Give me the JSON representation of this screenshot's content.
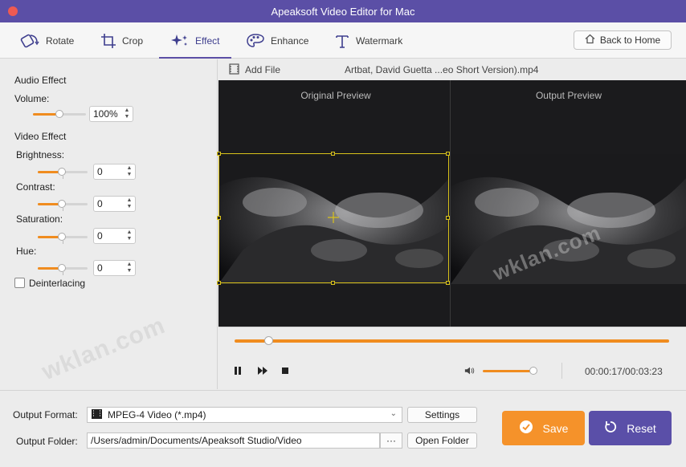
{
  "window": {
    "title": "Apeaksoft Video Editor for Mac"
  },
  "tabs": [
    {
      "label": "Rotate",
      "icon": "rotate-icon"
    },
    {
      "label": "Crop",
      "icon": "crop-icon"
    },
    {
      "label": "Effect",
      "icon": "effect-icon",
      "active": true
    },
    {
      "label": "Enhance",
      "icon": "enhance-icon"
    },
    {
      "label": "Watermark",
      "icon": "watermark-icon"
    }
  ],
  "home_button": {
    "label": "Back to Home",
    "icon": "home-icon"
  },
  "audio_effect": {
    "heading": "Audio Effect",
    "volume_label": "Volume:",
    "volume_value": "100%",
    "volume_level": 0.45
  },
  "video_effect": {
    "heading": "Video Effect",
    "brightness_label": "Brightness:",
    "brightness_value": "0",
    "contrast_label": "Contrast:",
    "contrast_value": "0",
    "saturation_label": "Saturation:",
    "saturation_value": "0",
    "hue_label": "Hue:",
    "hue_value": "0",
    "deinterlacing_label": "Deinterlacing",
    "deinterlacing_checked": false
  },
  "file_bar": {
    "add_file_label": "Add File",
    "file_name": "Artbat, David Guetta ...eo Short Version).mp4"
  },
  "preview": {
    "original_label": "Original Preview",
    "output_label": "Output Preview"
  },
  "playback": {
    "progress": 0.08,
    "volume": 0.9,
    "time": "00:00:17/00:03:23"
  },
  "output": {
    "format_label": "Output Format:",
    "format_value": "MPEG-4 Video (*.mp4)",
    "settings_label": "Settings",
    "folder_label": "Output Folder:",
    "folder_value": "/Users/admin/Documents/Apeaksoft Studio/Video",
    "browse_label": "···",
    "open_folder_label": "Open Folder"
  },
  "actions": {
    "save_label": "Save",
    "reset_label": "Reset",
    "save_color": "#f5922a",
    "reset_color": "#5a4fa8"
  },
  "watermark": "wklan.com"
}
